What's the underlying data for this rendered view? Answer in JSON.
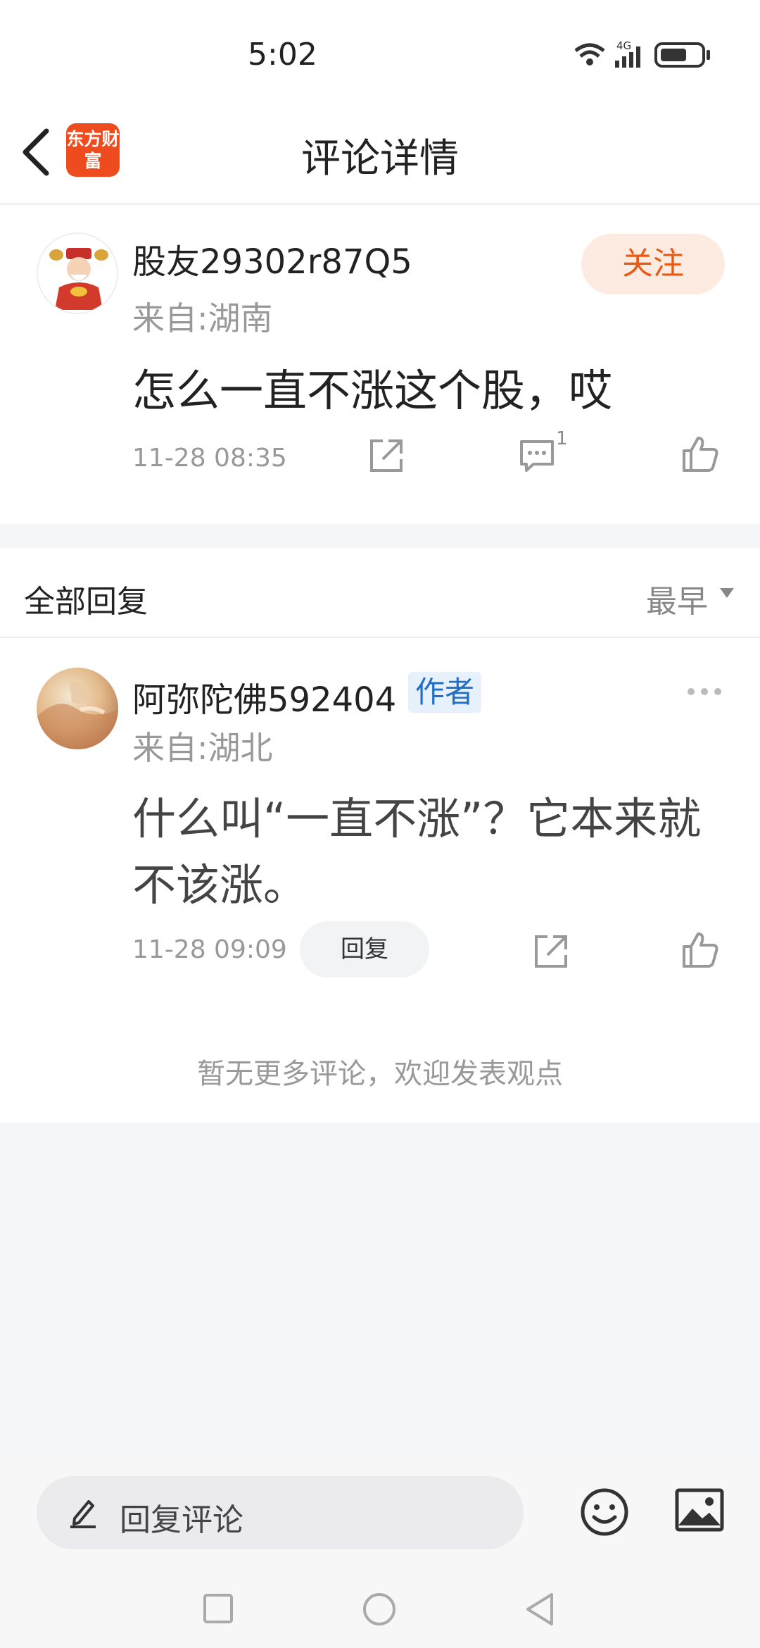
{
  "status_bar": {
    "time": "5:02",
    "network": "4G",
    "icons": [
      "wifi-icon",
      "signal-icon",
      "battery-icon"
    ]
  },
  "header": {
    "back_icon": "chevron-left-icon",
    "logo_text": "东方财富",
    "title": "评论详情"
  },
  "post": {
    "username": "股友29302r87Q5",
    "location": "来自:湖南",
    "follow_label": "关注",
    "content": "怎么一直不涨这个股，哎",
    "time": "11-28 08:35",
    "comment_count": "1"
  },
  "replies": {
    "section_title": "全部回复",
    "sort_label": "最早",
    "items": [
      {
        "username": "阿弥陀佛592404",
        "badge": "作者",
        "location": "来自:湖北",
        "content": "什么叫“一直不涨”？它本来就不该涨。",
        "time": "11-28 09:09",
        "reply_label": "回复"
      }
    ],
    "no_more_text": "暂无更多评论，欢迎发表观点"
  },
  "bottom_bar": {
    "input_placeholder": "回复评论",
    "icons": [
      "pencil-icon",
      "emoji-icon",
      "image-icon"
    ]
  },
  "colors": {
    "accent": "#ea5a14",
    "follow_bg": "#fdebe2",
    "author_badge": "#1f6fc7",
    "logo_bg": "#ee4b1f"
  }
}
